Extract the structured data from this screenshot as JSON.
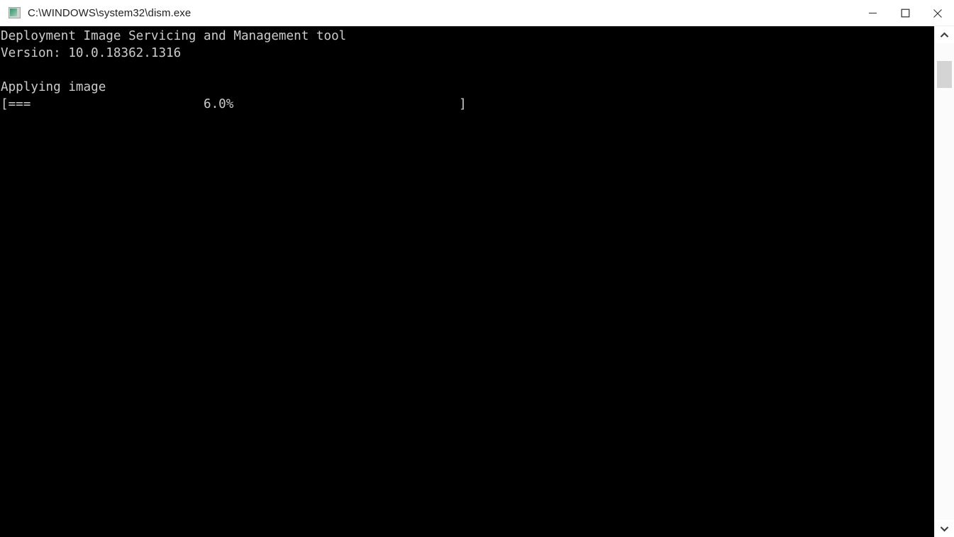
{
  "window": {
    "title": "C:\\WINDOWS\\system32\\dism.exe",
    "icon": "console-app-icon",
    "background_color": "#000000",
    "titlebar_color": "#ffffff",
    "text_color": "#cccccc"
  },
  "controls": {
    "minimize_label": "Minimize",
    "maximize_label": "Maximize",
    "close_label": "Close"
  },
  "console": {
    "lines": [
      "Deployment Image Servicing and Management tool",
      "Version: 10.0.18362.1316",
      "",
      "Applying image"
    ],
    "text": "Deployment Image Servicing and Management tool\nVersion: 10.0.18362.1316\n\nApplying image\n[===                       6.0%                              ]",
    "progress": {
      "bar_open": "[",
      "filled": "===",
      "percent_label": "6.0%",
      "bar_close": "]",
      "percent_value": 6.0,
      "filled_chars": 3,
      "total_chars": 58,
      "percent_column": 26,
      "close_column": 60
    }
  },
  "scrollbar": {
    "up_arrow": "chevron-up-icon",
    "down_arrow": "chevron-down-icon",
    "thumb_position_percent": 3,
    "track_color": "#fbfbfb",
    "thumb_color": "#d4d4d4"
  }
}
